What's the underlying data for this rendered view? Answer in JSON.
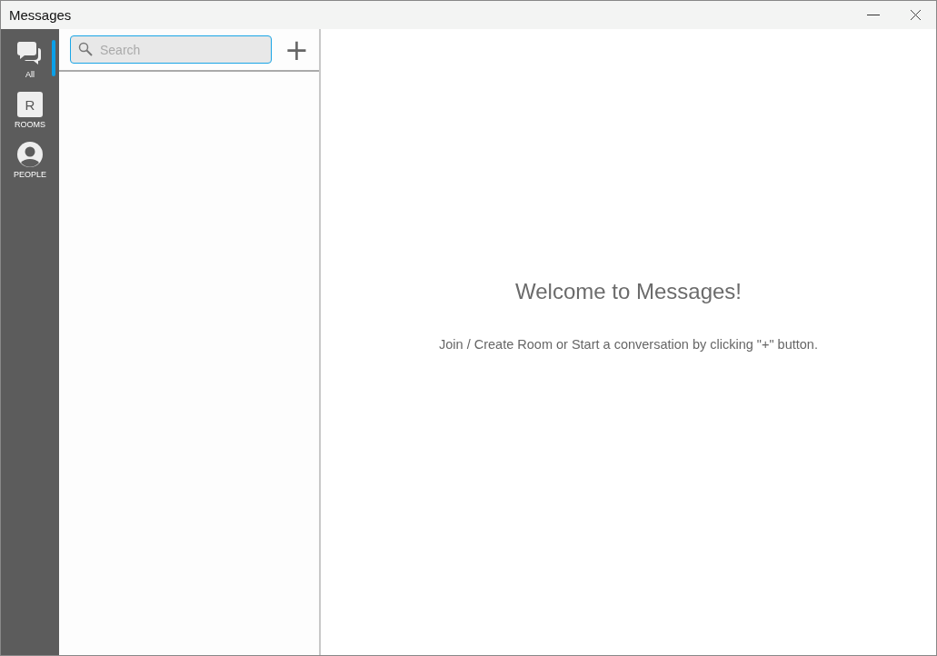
{
  "window": {
    "title": "Messages"
  },
  "nav": [
    {
      "kind": "chat",
      "label": "All",
      "selected": true
    },
    {
      "kind": "letter",
      "letter": "R",
      "label": "ROOMS",
      "selected": false
    },
    {
      "kind": "person",
      "label": "PEOPLE",
      "selected": false
    }
  ],
  "search": {
    "placeholder": "Search"
  },
  "add_button": {
    "label": "+"
  },
  "welcome": {
    "title": "Welcome to Messages!",
    "hint": "Join / Create Room or Start a conversation by clicking \"+\" button."
  }
}
